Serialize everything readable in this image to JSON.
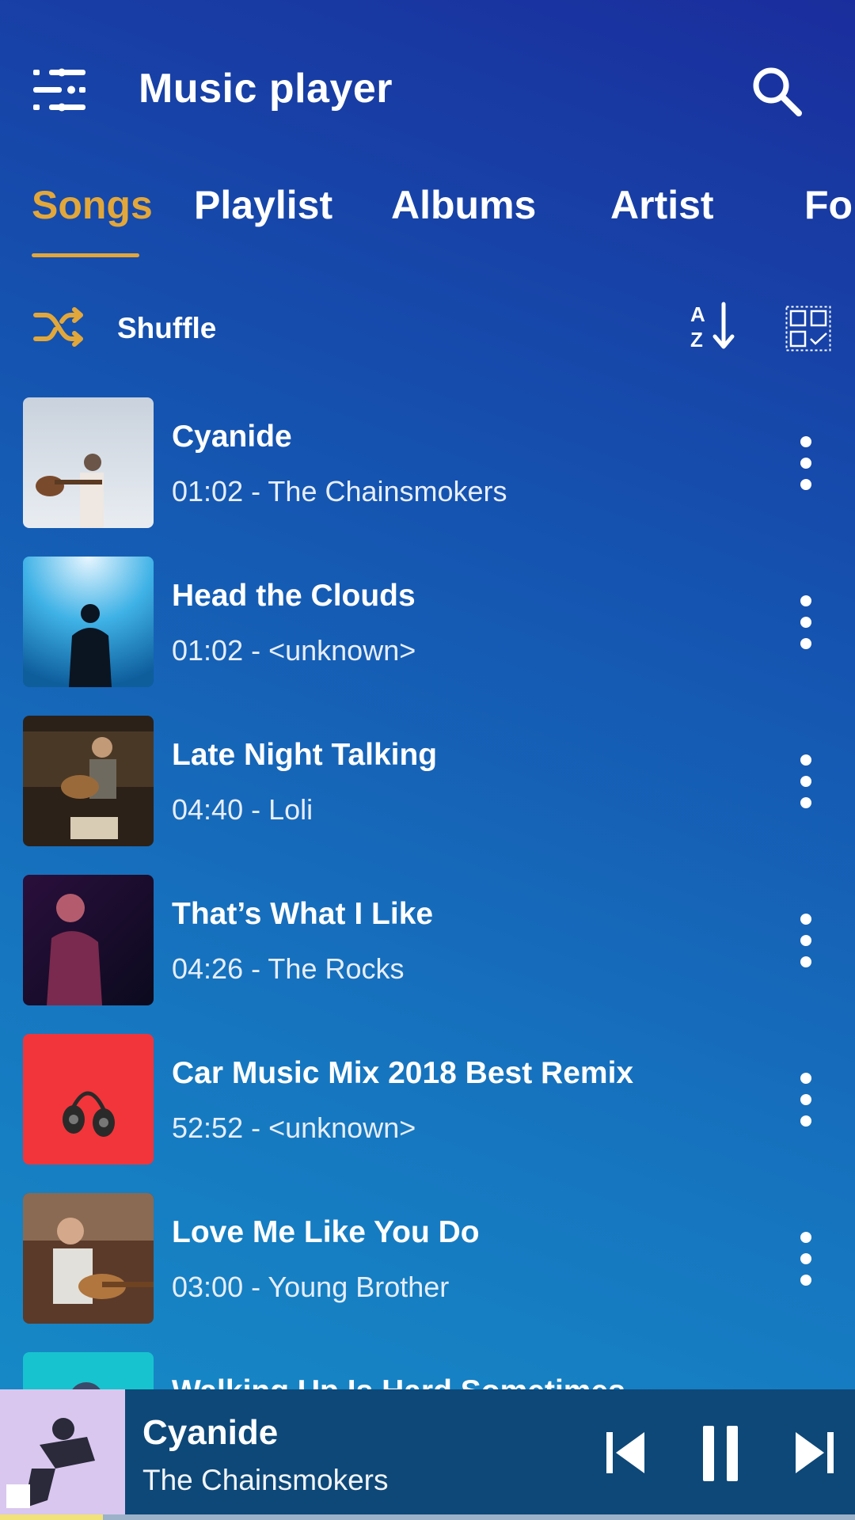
{
  "header": {
    "title": "Music player",
    "menu_icon": "menu-filter-icon",
    "search_icon": "search-icon"
  },
  "tabs": [
    {
      "label": "Songs",
      "active": true
    },
    {
      "label": "Playlist",
      "active": false
    },
    {
      "label": "Albums",
      "active": false
    },
    {
      "label": "Artist",
      "active": false
    },
    {
      "label": "Fol",
      "active": false
    }
  ],
  "toolbar": {
    "shuffle_label": "Shuffle",
    "sort_icon": "sort-az-icon",
    "select_icon": "multi-select-icon"
  },
  "accent_color": "#e2a73a",
  "songs": [
    {
      "title": "Cyanide",
      "subtitle": "01:02 - The Chainsmokers"
    },
    {
      "title": "Head the Clouds",
      "subtitle": "01:02 - <unknown>"
    },
    {
      "title": "Late Night Talking",
      "subtitle": "04:40 - Loli"
    },
    {
      "title": "That’s What I Like",
      "subtitle": "04:26 - The Rocks"
    },
    {
      "title": "Car Music Mix 2018 Best Remix",
      "subtitle": "52:52 - <unknown>"
    },
    {
      "title": "Love Me Like You Do",
      "subtitle": "03:00 - Young Brother"
    },
    {
      "title": "Walking Up Is Hard Sometimes",
      "subtitle": ""
    }
  ],
  "now_playing": {
    "title": "Cyanide",
    "artist": "The Chainsmokers",
    "progress_fraction": 0.12
  }
}
